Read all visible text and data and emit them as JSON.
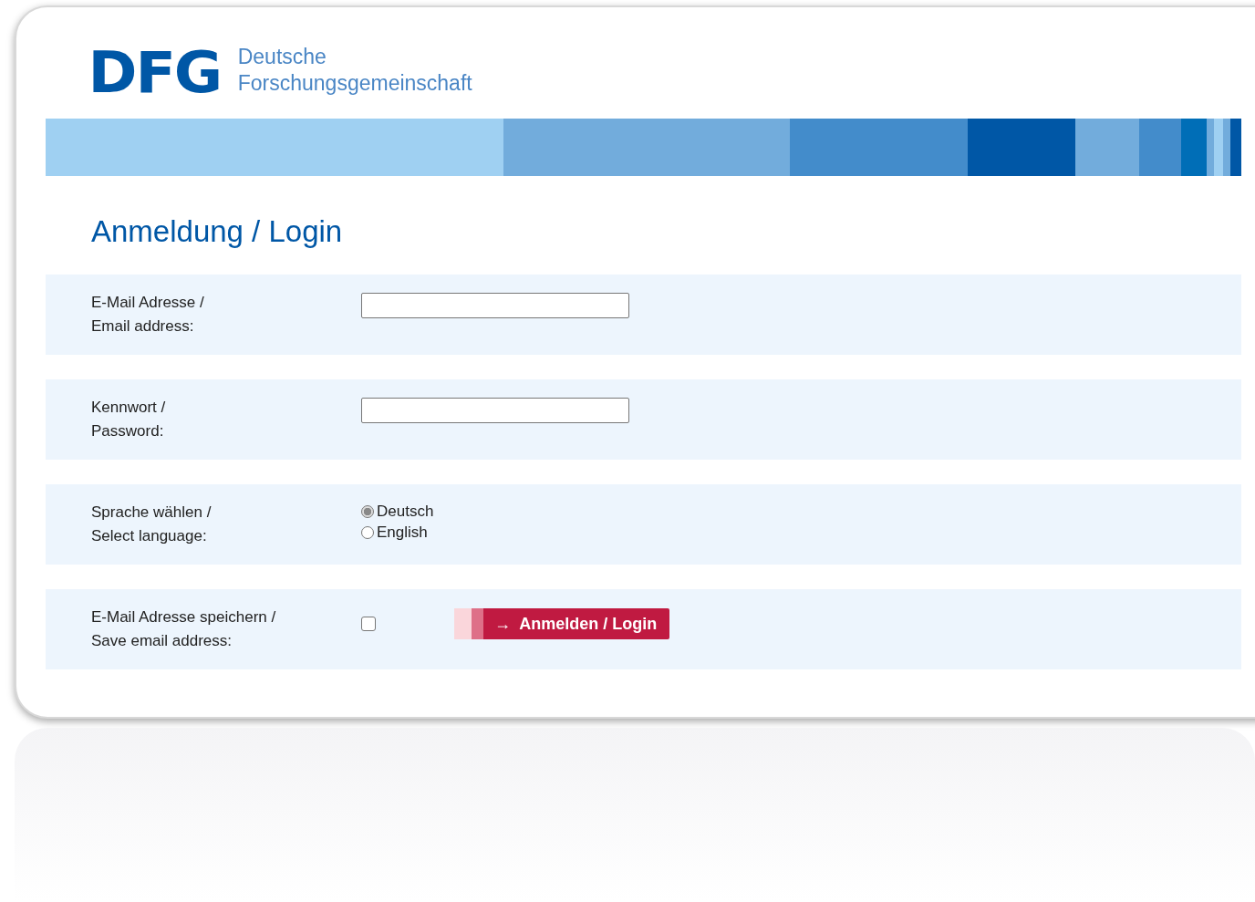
{
  "logo": {
    "mark": "DFG",
    "name_line_1": "Deutsche",
    "name_line_2": "Forschungsgemeinschaft"
  },
  "title": "Anmeldung / Login",
  "form": {
    "email": {
      "label_line_1": "E-Mail Adresse /",
      "label_line_2": "Email address:"
    },
    "password": {
      "label_line_1": "Kennwort /",
      "label_line_2": "Password:"
    },
    "language": {
      "label_line_1": "Sprache wählen /",
      "label_line_2": "Select language:",
      "options": [
        {
          "label": "Deutsch",
          "selected": true
        },
        {
          "label": "English",
          "selected": false
        }
      ]
    },
    "save_email": {
      "label_line_1": "E-Mail Adresse speichern /",
      "label_line_2": "Save email address:",
      "checked": false
    },
    "login_button": {
      "icon": "→",
      "label": "Anmelden / Login"
    }
  }
}
